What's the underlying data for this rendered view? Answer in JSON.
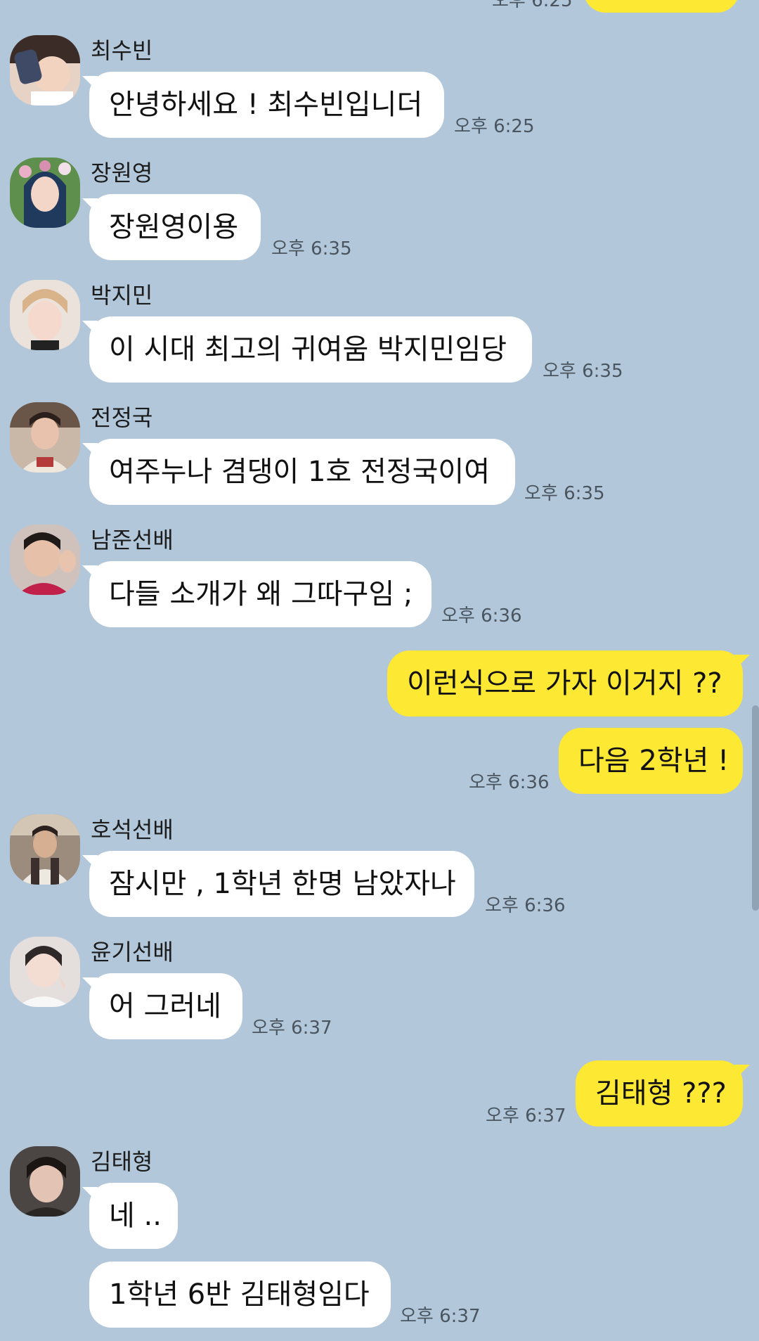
{
  "chat": {
    "top_partial_time": "오후 6:25",
    "messages": [
      {
        "sender": "최수빈",
        "text": "안녕하세요 ! 최수빈입니더",
        "time": "오후 6:25"
      },
      {
        "sender": "장원영",
        "text": "장원영이용",
        "time": "오후 6:35"
      },
      {
        "sender": "박지민",
        "text": "이 시대 최고의 귀여움 박지민임당",
        "time": "오후 6:35"
      },
      {
        "sender": "전정국",
        "text": "여주누나 겸댕이 1호 전정국이여",
        "time": "오후 6:35"
      },
      {
        "sender": "남준선배",
        "text": "다들 소개가 왜 그따구임 ;",
        "time": "오후 6:36"
      },
      {
        "sender": "",
        "text": "이런식으로 가자 이거지 ??",
        "time": ""
      },
      {
        "sender": "",
        "text": "다음 2학년 !",
        "time": "오후 6:36"
      },
      {
        "sender": "호석선배",
        "text": "잠시만 , 1학년 한명 남았자나",
        "time": "오후 6:36"
      },
      {
        "sender": "윤기선배",
        "text": "어 그러네",
        "time": "오후 6:37"
      },
      {
        "sender": "",
        "text": "김태형 ???",
        "time": "오후 6:37"
      },
      {
        "sender": "김태형",
        "text": "네 ..",
        "time": ""
      },
      {
        "sender": "",
        "text": "1학년 6반 김태형임다",
        "time": "오후 6:37"
      }
    ]
  },
  "colors": {
    "background": "#b2c7da",
    "incoming_bubble": "#ffffff",
    "outgoing_bubble": "#fde834"
  }
}
